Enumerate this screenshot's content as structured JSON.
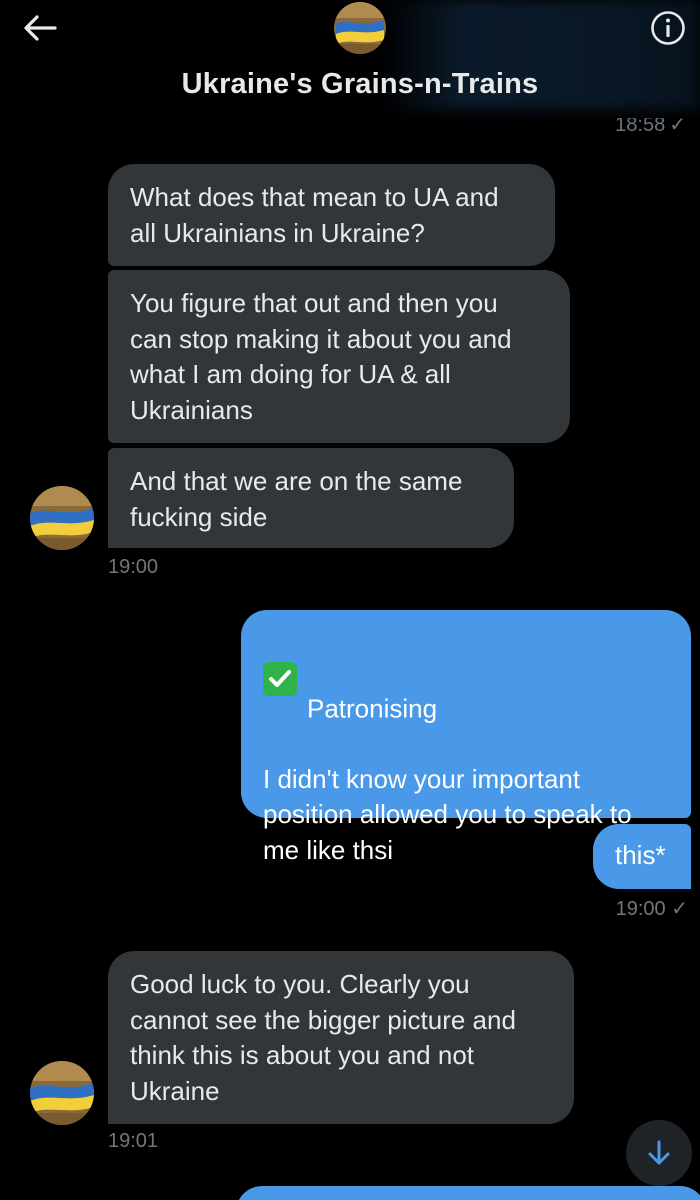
{
  "header": {
    "title": "Ukraine's Grains-n-Trains",
    "back_icon": "arrow-left-icon",
    "info_icon": "info-icon",
    "previous_timestamp": "18:58",
    "previous_status": "✓"
  },
  "messages": [
    {
      "direction": "incoming",
      "text": "What does that mean to UA and\nall Ukrainians in Ukraine?"
    },
    {
      "direction": "incoming",
      "text": "You figure that out and then you\ncan stop making it about you and\nwhat I am doing for UA & all\nUkrainians"
    },
    {
      "direction": "incoming",
      "text": "And that we are on the same\nfucking side"
    },
    {
      "direction": "outgoing",
      "text_line1": "Patronising",
      "text_body": "I didn't know your important\nposition allowed you to speak to\nme like thsi"
    },
    {
      "direction": "outgoing",
      "text": "this*"
    },
    {
      "direction": "incoming",
      "text": "Good luck to you. Clearly you\ncannot see the bigger picture and\nthink this is about you and not\nUkraine"
    }
  ],
  "timestamps": {
    "group1": "19:00",
    "group2": "19:00",
    "group2_status": "✓",
    "group3": "19:01"
  },
  "colors": {
    "background": "#000000",
    "incoming_bubble": "#333639",
    "outgoing_bubble": "#4a99e9",
    "meta_text": "#71767b",
    "flag_blue": "#2f6fc4",
    "flag_yellow": "#f2cf3a"
  },
  "scroll_button_icon": "arrow-down-icon"
}
